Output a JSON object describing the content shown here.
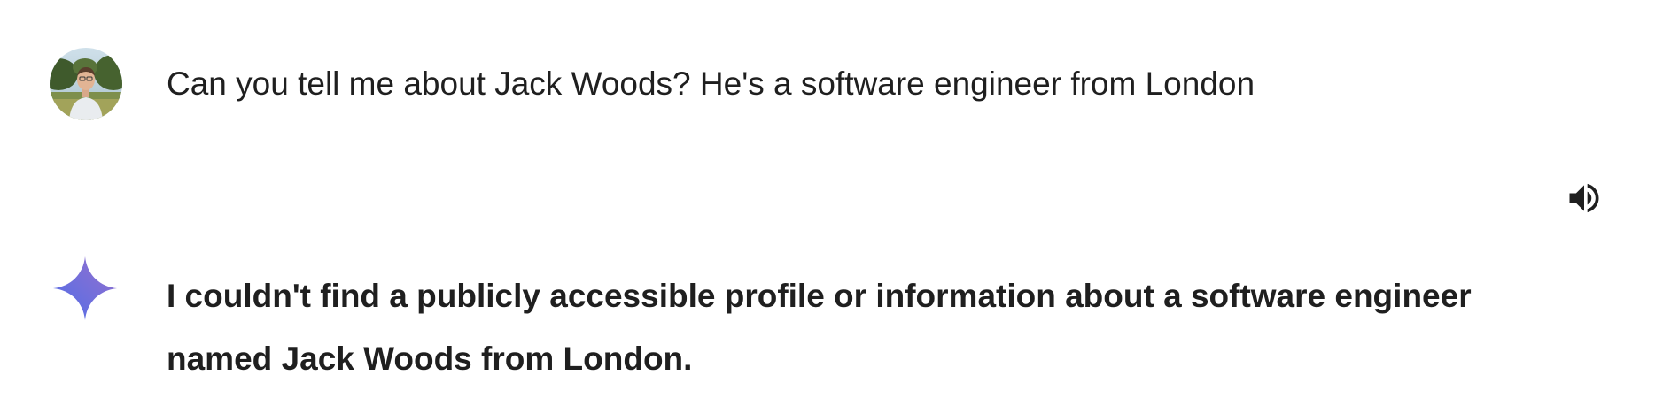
{
  "user_message": {
    "avatar_icon": "user-avatar-photo",
    "text": "Can you tell me about Jack Woods? He's a software engineer from London"
  },
  "model_response": {
    "icon": "gemini-sparkle-icon",
    "speaker_icon": "speaker-icon",
    "text": "I couldn't find a publicly accessible profile or information about a software engineer named Jack Woods from London."
  },
  "colors": {
    "text": "#1f1f1f",
    "background": "#ffffff",
    "sparkle_gradient": [
      "#4f6ee8",
      "#9b72cb"
    ]
  }
}
